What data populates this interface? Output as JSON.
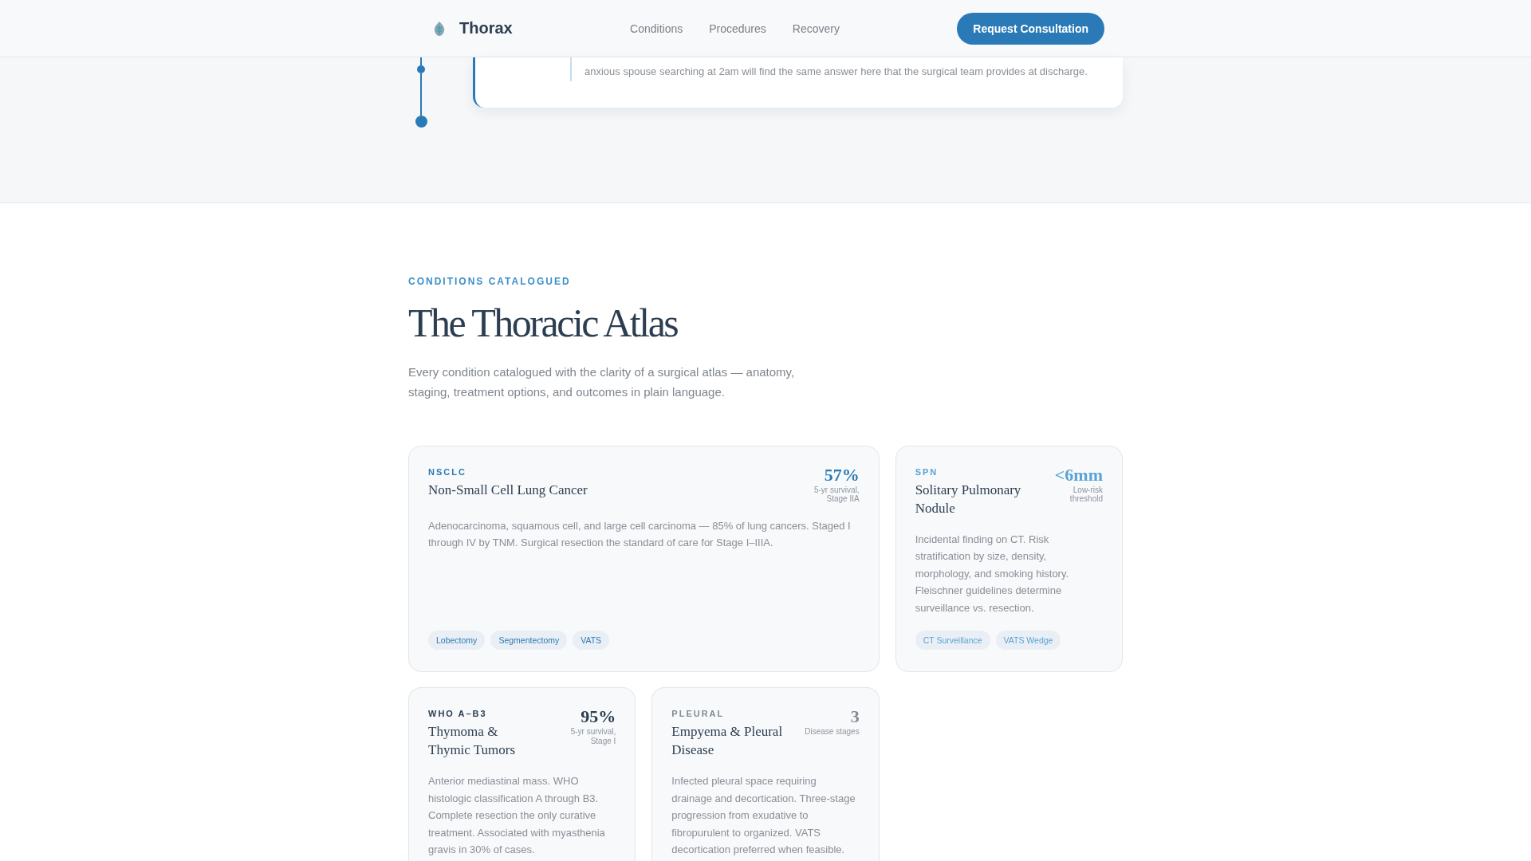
{
  "header": {
    "brand": "Thorax",
    "nav": [
      {
        "label": "Conditions"
      },
      {
        "label": "Procedures"
      },
      {
        "label": "Recovery"
      }
    ],
    "cta": "Request Consultation"
  },
  "timeline_card": {
    "quote": "anxious spouse searching at 2am will find the same answer here that the surgical team provides at discharge."
  },
  "atlas": {
    "eyebrow": "CONDITIONS CATALOGUED",
    "title": "The Thoracic Atlas",
    "intro": "Every condition catalogued with the clarity of a surgical atlas — anatomy, staging, treatment options, and outcomes in plain language.",
    "conditions": [
      {
        "code": "NSCLC",
        "name": "Non-Small Cell Lung Cancer",
        "stat": "57%",
        "stat_caption": "5-yr survival, Stage IIA",
        "description": "Adenocarcinoma, squamous cell, and large cell carcinoma — 85% of lung cancers. Staged I through IV by TNM. Surgical resection the standard of care for Stage I–IIIA.",
        "tags": [
          "Lobectomy",
          "Segmentectomy",
          "VATS"
        ],
        "color": "#2b7bb6",
        "wide": true
      },
      {
        "code": "SPN",
        "name": "Solitary Pulmonary Nodule",
        "stat": "<6mm",
        "stat_caption": "Low-risk threshold",
        "description": "Incidental finding on CT. Risk stratification by size, density, morphology, and smoking history. Fleischner guidelines determine surveillance vs. resection.",
        "tags": [
          "CT Surveillance",
          "VATS Wedge"
        ],
        "color": "#5ba3d6",
        "wide": false
      },
      {
        "code": "WHO A–B3",
        "name": "Thymoma & Thymic Tumors",
        "stat": "95%",
        "stat_caption": "5-yr survival, Stage I",
        "description": "Anterior mediastinal mass. WHO histologic classification A through B3. Complete resection the only curative treatment. Associated with myasthenia gravis in 30% of cases.",
        "color": "#2c3e50",
        "wide": false
      },
      {
        "code": "PLEURAL",
        "name": "Empyema & Pleural Disease",
        "stat": "3",
        "stat_caption": "Disease stages",
        "description": "Infected pleural space requiring drainage and decortication. Three-stage progression from exudative to fibropurulent to organized. VATS decortication preferred when feasible.",
        "color": "#838b93",
        "wide": false
      }
    ]
  }
}
